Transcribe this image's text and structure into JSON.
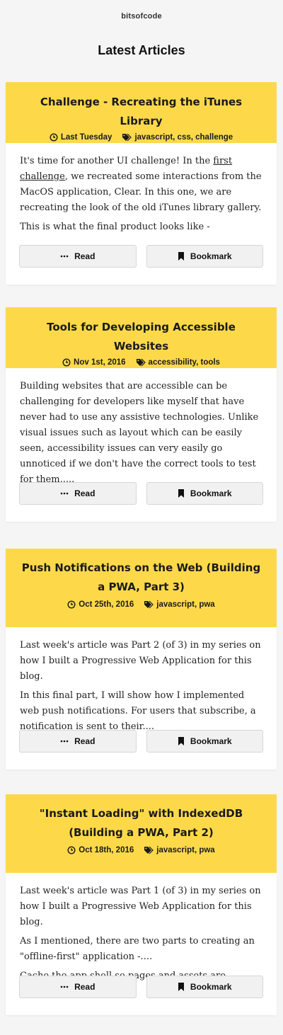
{
  "site": {
    "name": "bitsofcode"
  },
  "page": {
    "title": "Latest Articles"
  },
  "articles": [
    {
      "title": "Challenge - Recreating the iTunes Library",
      "date": "Last Tuesday",
      "tags": "javascript, css, challenge",
      "p1_before_link": "It's time for another UI challenge! In the ",
      "p1_link": "first challenge",
      "p1_after_link": ", we recreated some interactions from the MacOS application, Clear. In this one, we are recreating the look of the old iTunes library gallery.",
      "p2": "This is what the final product looks like -",
      "read_label": "Read",
      "bookmark_label": "Bookmark"
    },
    {
      "title": "Tools for Developing Accessible Websites",
      "date": "Nov 1st, 2016",
      "tags": "accessibility, tools",
      "p1": "Building websites that are accessible can be challenging for developers like myself that have never had to use any assistive technologies. Unlike visual issues such as layout which can be easily seen, accessibility issues can very easily go unnoticed if we don't have the correct tools to test for them.....",
      "read_label": "Read",
      "bookmark_label": "Bookmark"
    },
    {
      "title": "Push Notifications on the Web (Building a PWA, Part 3)",
      "date": "Oct 25th, 2016",
      "tags": "javascript, pwa",
      "p1": "Last week's article was Part 2 (of 3) in my series on how I built a Progressive Web Application for this blog.",
      "p2": "In this final part, I will show how I implemented web push notifications. For users that subscribe, a notification is sent to their....",
      "read_label": "Read",
      "bookmark_label": "Bookmark"
    },
    {
      "title": "\"Instant Loading\" with IndexedDB (Building a PWA, Part 2)",
      "date": "Oct 18th, 2016",
      "tags": "javascript, pwa",
      "p1": "Last week's article was Part 1 (of 3) in my series on how I built a Progressive Web Application for this blog.",
      "p2": "As I mentioned, there are two parts to creating an \"offline-first\" application -....",
      "p3": "Cache the app shell so pages and assets are accessible",
      "read_label": "Read",
      "bookmark_label": "Bookmark"
    }
  ],
  "colors": {
    "accent": "#fdd94a",
    "background": "#f5f5f5"
  },
  "icons": {
    "date": "clock-icon",
    "tags": "tag-icon",
    "read": "more-dots-icon",
    "bookmark": "bookmark-icon"
  }
}
